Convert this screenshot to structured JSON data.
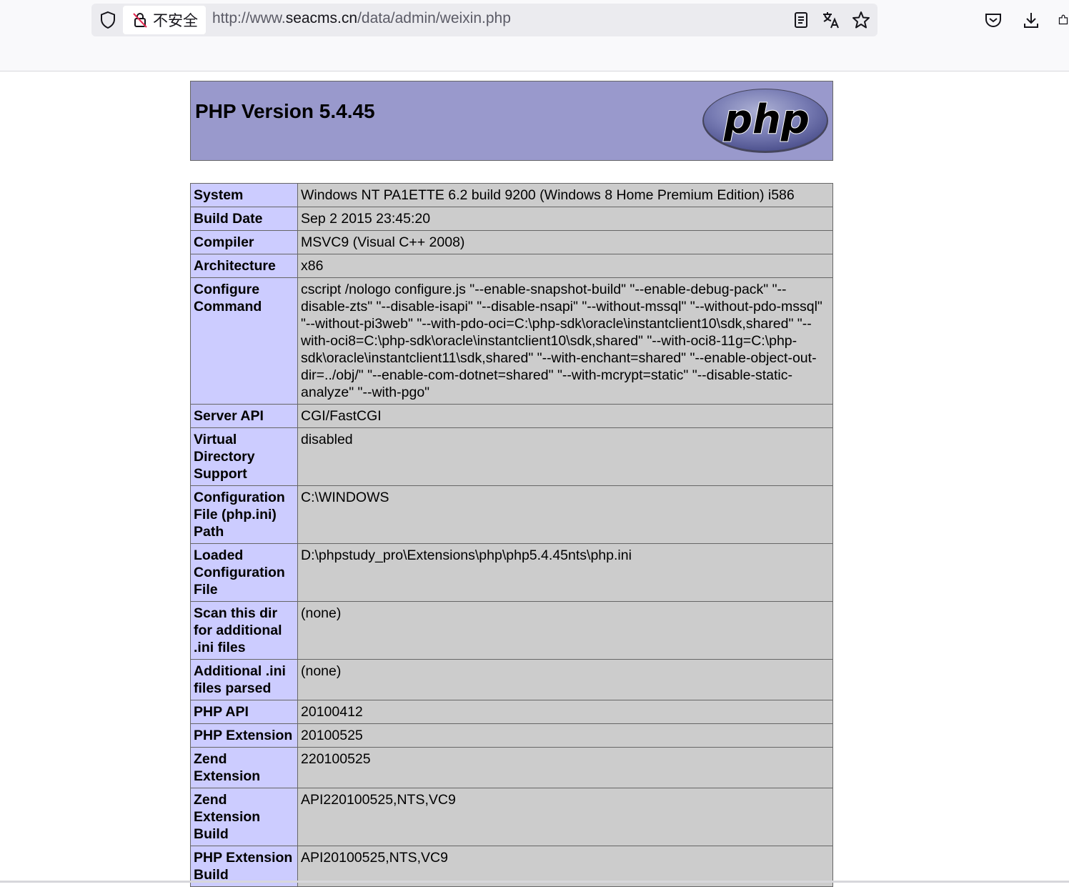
{
  "browser": {
    "security_label": "不安全",
    "url_prefix": "http://www.",
    "url_host": "seacms.cn",
    "url_path": "/data/admin/weixin.php",
    "icons": [
      "shield-icon",
      "insecure-lock-icon",
      "reader-view-icon",
      "translate-icon",
      "bookmark-star-icon",
      "pocket-icon",
      "download-icon",
      "extensions-icon"
    ]
  },
  "php": {
    "title": "PHP Version 5.4.45",
    "logo_text": "php",
    "colors": {
      "header_bg": "#9999cc",
      "key_bg": "#ccccff",
      "value_bg": "#cccccc",
      "border": "#666666"
    },
    "rows": [
      {
        "key": "System",
        "value": "Windows NT PA1ETTE 6.2 build 9200 (Windows 8 Home Premium Edition) i586"
      },
      {
        "key": "Build Date",
        "value": "Sep 2 2015 23:45:20"
      },
      {
        "key": "Compiler",
        "value": "MSVC9 (Visual C++ 2008)"
      },
      {
        "key": "Architecture",
        "value": "x86"
      },
      {
        "key": "Configure Command",
        "value": "cscript /nologo configure.js \"--enable-snapshot-build\" \"--enable-debug-pack\" \"--disable-zts\" \"--disable-isapi\" \"--disable-nsapi\" \"--without-mssql\" \"--without-pdo-mssql\" \"--without-pi3web\" \"--with-pdo-oci=C:\\php-sdk\\oracle\\instantclient10\\sdk,shared\" \"--with-oci8=C:\\php-sdk\\oracle\\instantclient10\\sdk,shared\" \"--with-oci8-11g=C:\\php-sdk\\oracle\\instantclient11\\sdk,shared\" \"--with-enchant=shared\" \"--enable-object-out-dir=../obj/\" \"--enable-com-dotnet=shared\" \"--with-mcrypt=static\" \"--disable-static-analyze\" \"--with-pgo\""
      },
      {
        "key": "Server API",
        "value": "CGI/FastCGI"
      },
      {
        "key": "Virtual Directory Support",
        "value": "disabled"
      },
      {
        "key": "Configuration File (php.ini) Path",
        "value": "C:\\WINDOWS"
      },
      {
        "key": "Loaded Configuration File",
        "value": "D:\\phpstudy_pro\\Extensions\\php\\php5.4.45nts\\php.ini"
      },
      {
        "key": "Scan this dir for additional .ini files",
        "value": "(none)"
      },
      {
        "key": "Additional .ini files parsed",
        "value": "(none)"
      },
      {
        "key": "PHP API",
        "value": "20100412"
      },
      {
        "key": "PHP Extension",
        "value": "20100525"
      },
      {
        "key": "Zend Extension",
        "value": "220100525"
      },
      {
        "key": "Zend Extension Build",
        "value": "API220100525,NTS,VC9"
      },
      {
        "key": "PHP Extension Build",
        "value": "API20100525,NTS,VC9"
      }
    ]
  }
}
